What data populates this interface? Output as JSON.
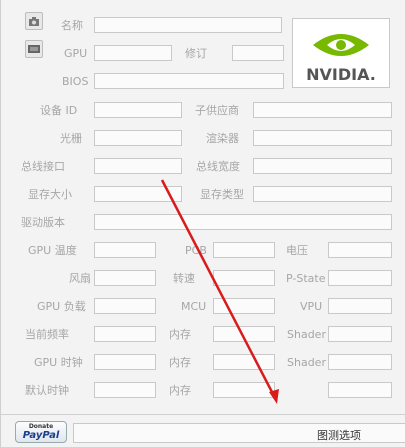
{
  "labels": {
    "name": "名称",
    "gpu": "GPU",
    "revision": "修订",
    "bios": "BIOS",
    "device_id": "设备 ID",
    "subvendor": "子供应商",
    "rops": "光栅",
    "shaders": "渲染器",
    "bus_interface": "总线接口",
    "bus_width": "总线宽度",
    "memory_size": "显存大小",
    "memory_type": "显存类型",
    "driver_version": "驱动版本",
    "gpu_temp": "GPU 温度",
    "pcb": "PCB",
    "voltage": "电压",
    "fan": "风扇",
    "speed": "转速",
    "pstate": "P-State",
    "gpu_load": "GPU 负载",
    "mcu": "MCU",
    "vpu": "VPU",
    "current_clock": "当前频率",
    "mem1": "内存",
    "shader1": "Shader",
    "gpu_clock": "GPU 时钟",
    "mem2": "内存",
    "shader2": "Shader",
    "default_clock": "默认时钟",
    "mem3": "内存"
  },
  "logo_text": "NVIDIA.",
  "paypal": {
    "donate": "Donate",
    "brand": "PayPal"
  },
  "options_label": "图测选项",
  "colors": {
    "nvidia_green": "#76b900",
    "arrow_red": "#d81b1b"
  }
}
